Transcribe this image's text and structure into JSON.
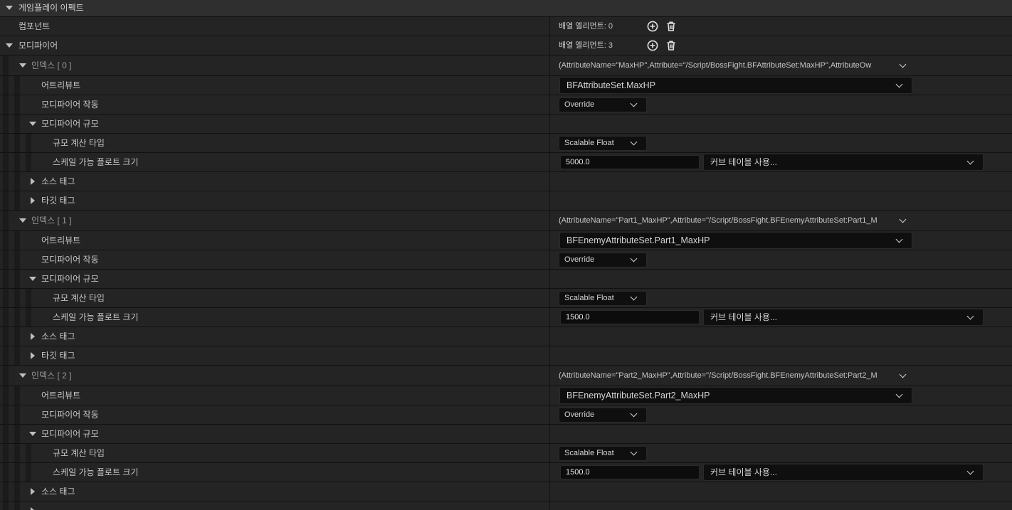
{
  "section": {
    "title": "게임플레이 이펙트"
  },
  "components": {
    "label": "컴포넌트",
    "count_text": "배열 엘리먼트: 0"
  },
  "modifiers": {
    "label": "모디파이어",
    "count_text": "배열 엘리먼트: 3",
    "items": [
      {
        "index_label": "인덱스 [ 0 ]",
        "summary": "(AttributeName=\"MaxHP\",Attribute=\"/Script/BossFight.BFAttributeSet:MaxHP\",AttributeOw",
        "attribute_label": "어트리뷰트",
        "attribute_value": "BFAttributeSet.MaxHP",
        "op_label": "모디파이어 작동",
        "op_value": "Override",
        "magnitude_label": "모디파이어 규모",
        "calc_type_label": "규모 계산 타입",
        "calc_type_value": "Scalable Float",
        "scalable_label": "스케일 가능 플로트 크기",
        "scalable_value": "5000.0",
        "curve_table": "커브 테이블 사용...",
        "source_tags_label": "소스 태그",
        "target_tags_label": "타깃 태그"
      },
      {
        "index_label": "인덱스 [ 1 ]",
        "summary": "(AttributeName=\"Part1_MaxHP\",Attribute=\"/Script/BossFight.BFEnemyAttributeSet:Part1_M",
        "attribute_label": "어트리뷰트",
        "attribute_value": "BFEnemyAttributeSet.Part1_MaxHP",
        "op_label": "모디파이어 작동",
        "op_value": "Override",
        "magnitude_label": "모디파이어 규모",
        "calc_type_label": "규모 계산 타입",
        "calc_type_value": "Scalable Float",
        "scalable_label": "스케일 가능 플로트 크기",
        "scalable_value": "1500.0",
        "curve_table": "커브 테이블 사용...",
        "source_tags_label": "소스 태그",
        "target_tags_label": "타깃 태그"
      },
      {
        "index_label": "인덱스 [ 2 ]",
        "summary": "(AttributeName=\"Part2_MaxHP\",Attribute=\"/Script/BossFight.BFEnemyAttributeSet:Part2_M",
        "attribute_label": "어트리뷰트",
        "attribute_value": "BFEnemyAttributeSet.Part2_MaxHP",
        "op_label": "모디파이어 작동",
        "op_value": "Override",
        "magnitude_label": "모디파이어 규모",
        "calc_type_label": "규모 계산 타입",
        "calc_type_value": "Scalable Float",
        "scalable_label": "스케일 가능 플로트 크기",
        "scalable_value": "1500.0",
        "curve_table": "커브 테이블 사용...",
        "source_tags_label": "소스 태그",
        "target_tags_label": ""
      }
    ]
  },
  "icons": {
    "add": "add-element-icon",
    "delete": "trash-icon",
    "expand": "triangle-down-icon",
    "collapse": "triangle-right-icon",
    "dropdown": "chevron-down-icon"
  },
  "colors": {
    "bg": "#151515",
    "row": "#242424",
    "header": "#2f2f2f",
    "field": "#0f0f0f",
    "text": "#c6c6c6"
  }
}
